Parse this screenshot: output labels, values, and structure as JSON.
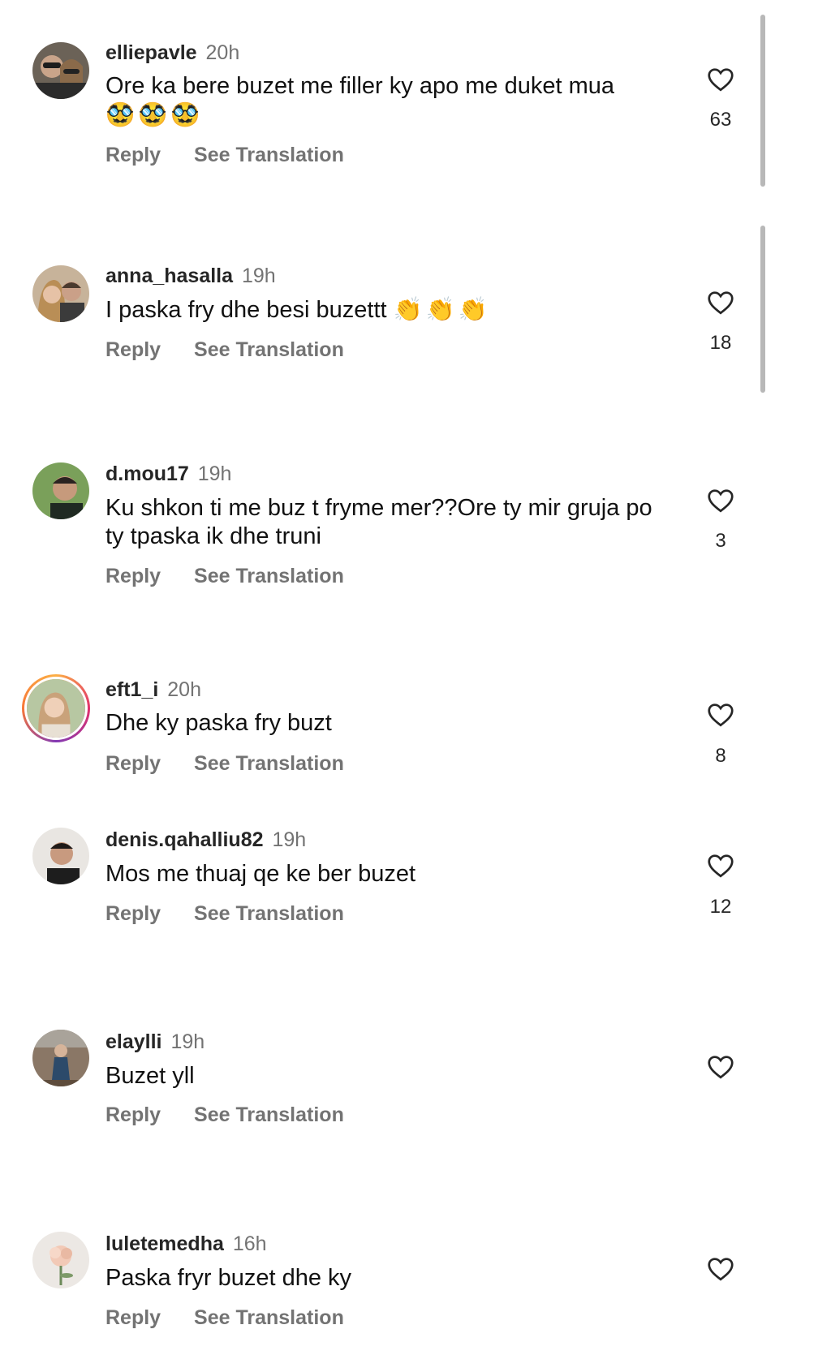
{
  "comments": [
    {
      "username": "elliepavle",
      "time": "20h",
      "text": "Ore ka bere buzet me filler ky apo me duket mua",
      "emoji": "🥸🥸🥸",
      "reply": "Reply",
      "translate": "See Translation",
      "likes": "63",
      "avatar_icon": "couple-photo-avatar"
    },
    {
      "username": "anna_hasalla",
      "time": "19h",
      "text": "I paska fry dhe besi buzettt",
      "emoji": "👏👏👏",
      "reply": "Reply",
      "translate": "See Translation",
      "likes": "18",
      "avatar_icon": "couple-photo-avatar"
    },
    {
      "username": "d.mou17",
      "time": "19h",
      "text": "Ku shkon ti me buz t fryme mer??Ore ty mir gruja po ty tpaska ik dhe truni",
      "reply": "Reply",
      "translate": "See Translation",
      "likes": "3",
      "avatar_icon": "man-photo-avatar"
    },
    {
      "username": "eft1_i",
      "time": "20h",
      "text": "Dhe ky paska fry buzt",
      "reply": "Reply",
      "translate": "See Translation",
      "likes": "8",
      "avatar_icon": "woman-photo-avatar-story-ring"
    },
    {
      "username": "denis.qahalliu82",
      "time": "19h",
      "text": "Mos me thuaj qe ke ber buzet",
      "reply": "Reply",
      "translate": "See Translation",
      "likes": "12",
      "avatar_icon": "man-photo-avatar"
    },
    {
      "username": "elaylli",
      "time": "19h",
      "text": "Buzet yll",
      "reply": "Reply",
      "translate": "See Translation",
      "likes": "",
      "avatar_icon": "person-photo-avatar"
    },
    {
      "username": "luletemedha",
      "time": "16h",
      "text": "Paska fryr buzet dhe ky",
      "reply": "Reply",
      "translate": "See Translation",
      "likes": "",
      "avatar_icon": "flower-photo-avatar"
    }
  ],
  "colors": {
    "text": "#111111",
    "secondary": "#737373",
    "scrollbar": "#b8b8b8"
  },
  "icons": {
    "like": "heart-outline-icon"
  }
}
